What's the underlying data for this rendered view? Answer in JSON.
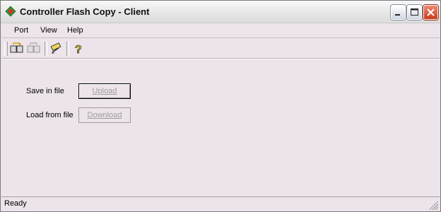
{
  "window": {
    "title": "Controller Flash Copy - Client"
  },
  "menubar": {
    "items": [
      "Port",
      "View",
      "Help"
    ]
  },
  "toolbar": {
    "icons": [
      "connect-icon",
      "disconnect-icon",
      "settings-icon",
      "help-icon"
    ]
  },
  "main": {
    "save_label": "Save in file",
    "upload_label": "Upload",
    "load_label": "Load from file",
    "download_label": "Download"
  },
  "status": {
    "text": "Ready"
  },
  "colors": {
    "background": "#ece4ea",
    "disabled_text": "#9d9d9d",
    "close_button": "#c6391b"
  }
}
